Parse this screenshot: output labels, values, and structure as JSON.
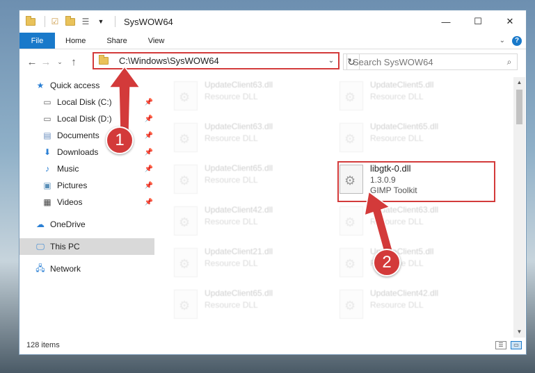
{
  "window": {
    "title": "SysWOW64",
    "controls": {
      "minimize": "—",
      "maximize": "☐",
      "close": "✕"
    }
  },
  "ribbon": {
    "tabs": [
      "File",
      "Home",
      "Share",
      "View"
    ],
    "help": "?"
  },
  "address": {
    "path": "C:\\Windows\\SysWOW64"
  },
  "search": {
    "placeholder": "Search SysWOW64"
  },
  "sidebar": {
    "items": [
      {
        "label": "Quick access",
        "icon": "star-icon"
      },
      {
        "label": "Local Disk (C:)",
        "icon": "drive-icon"
      },
      {
        "label": "Local Disk (D:)",
        "icon": "drive-icon"
      },
      {
        "label": "Documents",
        "icon": "documents-icon"
      },
      {
        "label": "Downloads",
        "icon": "download-icon"
      },
      {
        "label": "Music",
        "icon": "music-icon"
      },
      {
        "label": "Pictures",
        "icon": "pictures-icon"
      },
      {
        "label": "Videos",
        "icon": "videos-icon"
      },
      {
        "label": "OneDrive",
        "icon": "cloud-icon"
      },
      {
        "label": "This PC",
        "icon": "computer-icon"
      },
      {
        "label": "Network",
        "icon": "network-icon"
      }
    ]
  },
  "files": {
    "left": [
      {
        "name": "UpdateClient63.dll",
        "desc": "Resource DLL"
      },
      {
        "name": "UpdateClient63.dll",
        "desc": "Resource DLL"
      },
      {
        "name": "UpdateClient65.dll",
        "desc": "Resource DLL"
      },
      {
        "name": "UpdateClient42.dll",
        "desc": "Resource DLL"
      },
      {
        "name": "UpdateClient21.dll",
        "desc": "Resource DLL"
      },
      {
        "name": "UpdateClient65.dll",
        "desc": "Resource DLL"
      }
    ],
    "right": [
      {
        "name": "UpdateClient5.dll",
        "desc": "Resource DLL"
      },
      {
        "name": "UpdateClient65.dll",
        "desc": "Resource DLL"
      },
      {
        "name": "UpdateClient63.dll",
        "desc": "Resource DLL"
      },
      {
        "name": "UpdateClient5.dll",
        "desc": "Resource DLL"
      },
      {
        "name": "UpdateClient42.dll",
        "desc": "Resource DLL"
      }
    ],
    "highlighted": {
      "name": "libgtk-0.dll",
      "version": "1.3.0.9",
      "desc": "GIMP Toolkit"
    }
  },
  "status": {
    "count": "128 items"
  },
  "annotations": {
    "step1": "1",
    "step2": "2",
    "color": "#d33a3a"
  }
}
